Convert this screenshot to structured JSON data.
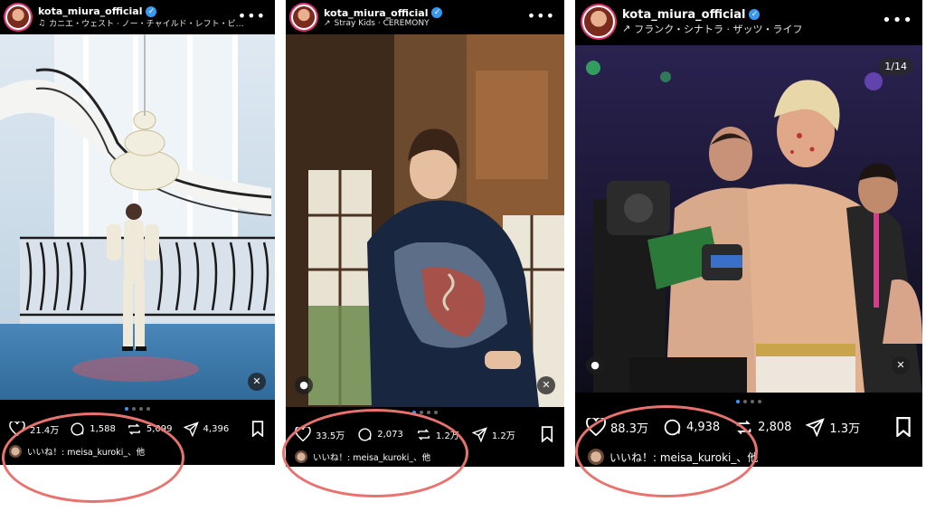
{
  "posts": [
    {
      "username": "kota_miura_official",
      "music": "カニエ・ウェスト · ノー・チャイルド・レフト・ビ…",
      "likes": "21.4万",
      "comments": "1,588",
      "reposts": "5,099",
      "shares": "4,396",
      "liked_by": "いいね！: meisa_kuroki_、他",
      "dots": 4,
      "active_dot": 1
    },
    {
      "username": "kota_miura_official",
      "music": "Stray Kids · CEREMONY",
      "likes": "33.5万",
      "comments": "2,073",
      "reposts": "1.2万",
      "shares": "1.2万",
      "liked_by": "いいね！: meisa_kuroki_、他",
      "dots": 4,
      "active_dot": 1
    },
    {
      "username": "kota_miura_official",
      "music": "フランク・シナトラ · ザッツ・ライフ",
      "likes": "88.3万",
      "comments": "4,938",
      "reposts": "2,808",
      "shares": "1.3万",
      "liked_by": "いいね！: meisa_kuroki_、他",
      "slide_counter": "1/14",
      "dots": 4,
      "active_dot": 0
    }
  ],
  "icons": {
    "heart": "heart-icon",
    "comment": "comment-icon",
    "repost": "repost-icon",
    "share": "share-icon",
    "save": "bookmark-icon",
    "more": "more-icon",
    "mute": "muted-icon",
    "tag": "user-tag-icon"
  },
  "colors": {
    "annotation_circle": "#e8736e",
    "verified": "#3897f0",
    "background": "#000000"
  }
}
